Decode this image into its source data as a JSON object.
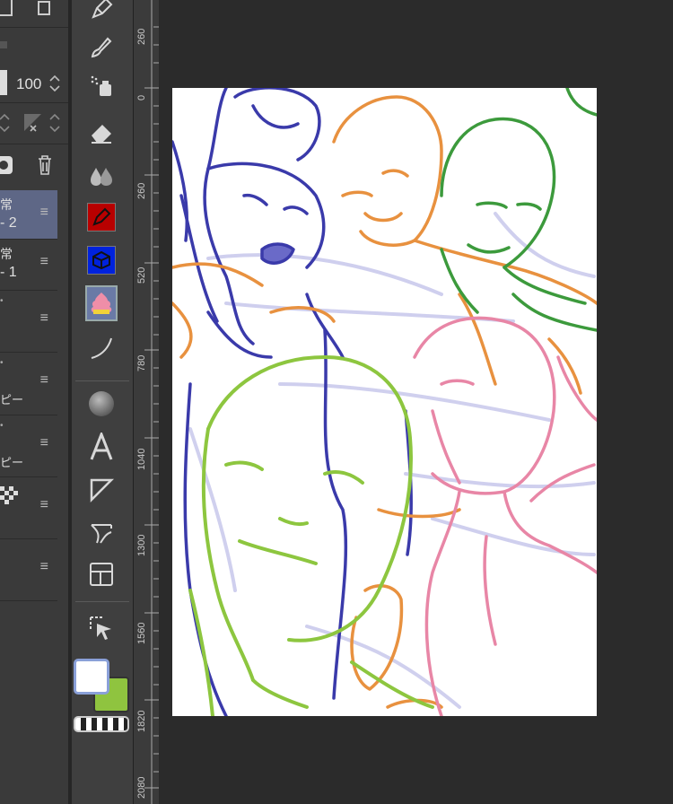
{
  "layer_panel": {
    "opacity_value": "100",
    "layers": [
      {
        "blend": "常",
        "name": "- 2"
      },
      {
        "blend": "常",
        "name": "- 1"
      },
      {
        "blend": "",
        "name": ""
      },
      {
        "blend": "",
        "name": "ピー"
      },
      {
        "blend": "",
        "name": "ピー"
      },
      {
        "blend": "",
        "name": ""
      },
      {
        "blend": "",
        "name": ""
      }
    ]
  },
  "toolbar": {
    "tools": [
      "pen-icon",
      "brush-icon",
      "airbrush-icon",
      "eraser-icon",
      "blend-icon",
      "fill-icon",
      "figure-fill-icon",
      "decoration-icon",
      "curve-icon",
      "gradient-icon",
      "text-icon",
      "shape-icon",
      "ruler-icon",
      "frame-icon",
      "select-layer-icon"
    ],
    "main_color": "#ffffff",
    "sub_color": "#8fc43f"
  },
  "ruler": {
    "ticks": [
      "260",
      "0",
      "260",
      "520",
      "780",
      "1040",
      "1300",
      "1560",
      "1820",
      "2080"
    ]
  },
  "colors": {
    "blue": "#3a3aaa",
    "orange": "#e8913f",
    "green_dark": "#3c9a3c",
    "green_light": "#8dc63f",
    "pink": "#e886a6",
    "lavender": "#b8b8e6"
  }
}
